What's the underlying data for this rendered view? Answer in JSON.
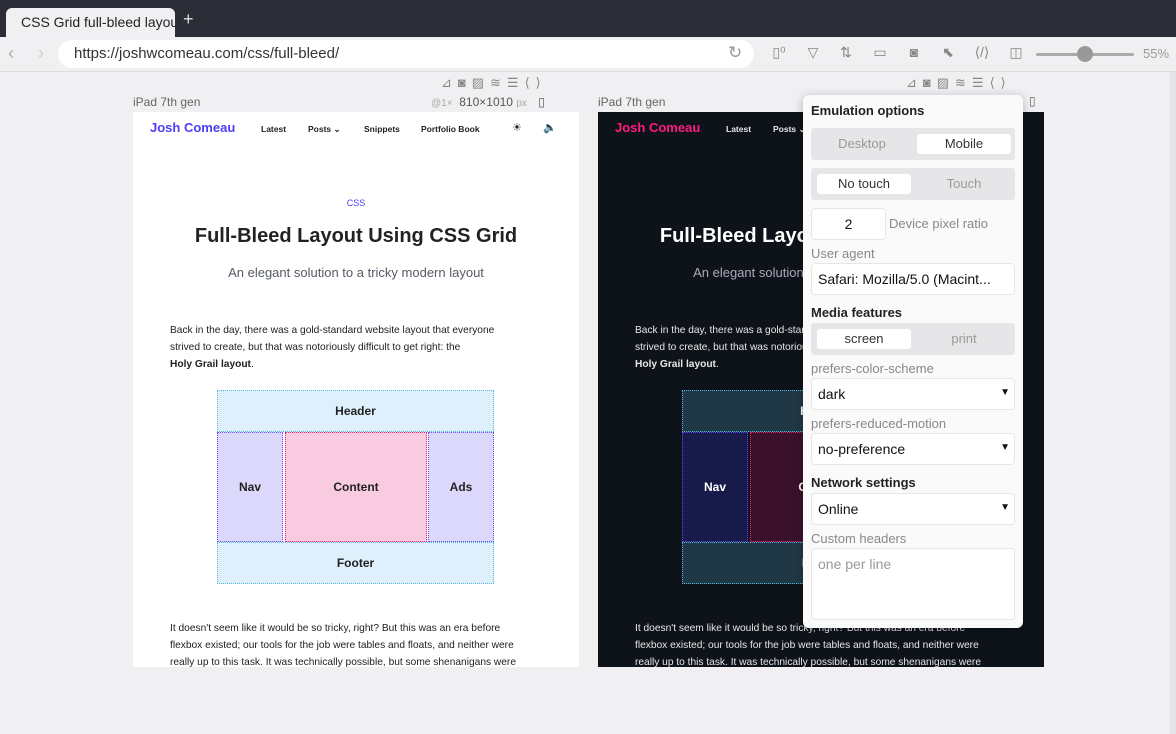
{
  "browser": {
    "tab_title": "CSS Grid full-bleed layout",
    "new_tab": "+",
    "url": "https://joshwcomeau.com/css/full-bleed/",
    "zoom": "55%"
  },
  "devices": [
    {
      "name": "iPad 7th gen",
      "scale": "@1×",
      "width": "810",
      "times": "×",
      "height": "1010",
      "unit": "px"
    },
    {
      "name": "iPad 7th gen"
    }
  ],
  "site": {
    "logo_first": "Josh",
    "logo_second": "Comeau",
    "nav": [
      "Latest",
      "Posts",
      "Snippets",
      "Portfolio Book"
    ],
    "category": "CSS",
    "title": "Full-Bleed Layout Using CSS Grid",
    "subtitle": "An elegant solution to a tricky modern layout",
    "para1": [
      "Back in the day, there was a gold-standard website layout that everyone",
      "strived to create, but that was notoriously difficult to get right: the"
    ],
    "para1_bold": "Holy Grail layout",
    "para1_end": ".",
    "grid": {
      "header": "Header",
      "nav": "Nav",
      "content": "Content",
      "ads": "Ads",
      "footer": "Footer"
    },
    "para2": [
      "It doesn't seem like it would be so tricky, right? But this was an era before",
      "flexbox existed; our tools for the job were tables and floats, and neither were",
      "really up to this task. It was technically possible, but some shenanigans were"
    ]
  },
  "emulation": {
    "title": "Emulation options",
    "device_mode": [
      "Desktop",
      "Mobile"
    ],
    "touch_mode": [
      "No touch",
      "Touch"
    ],
    "dpr": "2",
    "dpr_label": "Device pixel ratio",
    "ua_label": "User agent",
    "ua_value": "Safari: Mozilla/5.0 (Macint...",
    "media_title": "Media features",
    "media": [
      "screen",
      "print"
    ],
    "pcs_label": "prefers-color-scheme",
    "pcs_value": "dark",
    "prm_label": "prefers-reduced-motion",
    "prm_value": "no-preference",
    "network_title": "Network settings",
    "network_value": "Online",
    "headers_label": "Custom headers",
    "headers_placeholder": "one per line"
  },
  "colors": {
    "brand_light": "#4f3cf5",
    "brand_dark": "#ff1b7d"
  }
}
